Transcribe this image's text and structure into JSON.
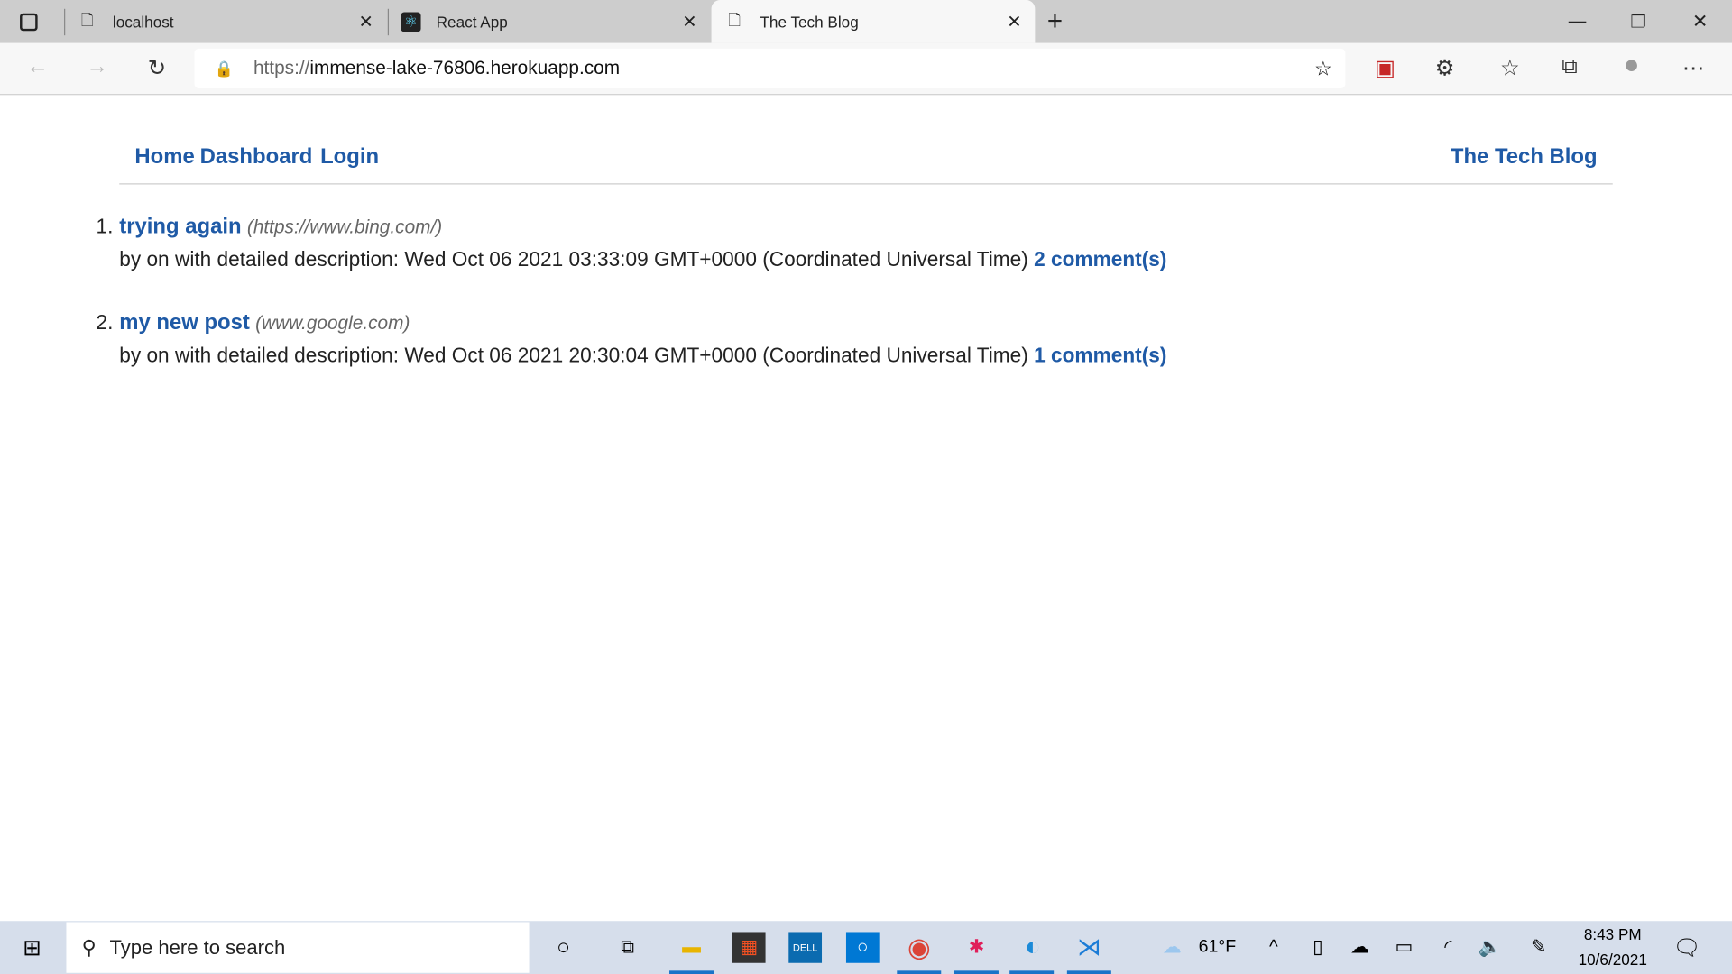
{
  "browser": {
    "tabs": [
      {
        "label": "localhost",
        "icon": "page-error-icon"
      },
      {
        "label": "React App",
        "icon": "react-icon"
      },
      {
        "label": "The Tech Blog",
        "icon": "page-icon",
        "active": true
      }
    ],
    "url_prefix": "https://",
    "url_host": "immense-lake-76806.herokuapp.com"
  },
  "page": {
    "nav": {
      "home": "Home",
      "dashboard": "Dashboard",
      "login": "Login",
      "brand": "The Tech Blog"
    },
    "posts": [
      {
        "num": "1.",
        "title": "trying again",
        "url": "(https://www.bing.com/)",
        "meta": "by on with detailed description: Wed Oct 06 2021 03:33:09 GMT+0000 (Coordinated Universal Time)",
        "comments": "2 comment(s)"
      },
      {
        "num": "2.",
        "title": "my new post",
        "url": "(www.google.com)",
        "meta": "by on with detailed description: Wed Oct 06 2021 20:30:04 GMT+0000 (Coordinated Universal Time)",
        "comments": "1 comment(s)"
      }
    ]
  },
  "taskbar": {
    "search_placeholder": "Type here to search",
    "weather": "61°F",
    "time": "8:43 PM",
    "date": "10/6/2021"
  },
  "colors": {
    "link": "#1f5aa6",
    "taskbar": "#d6deeb"
  }
}
